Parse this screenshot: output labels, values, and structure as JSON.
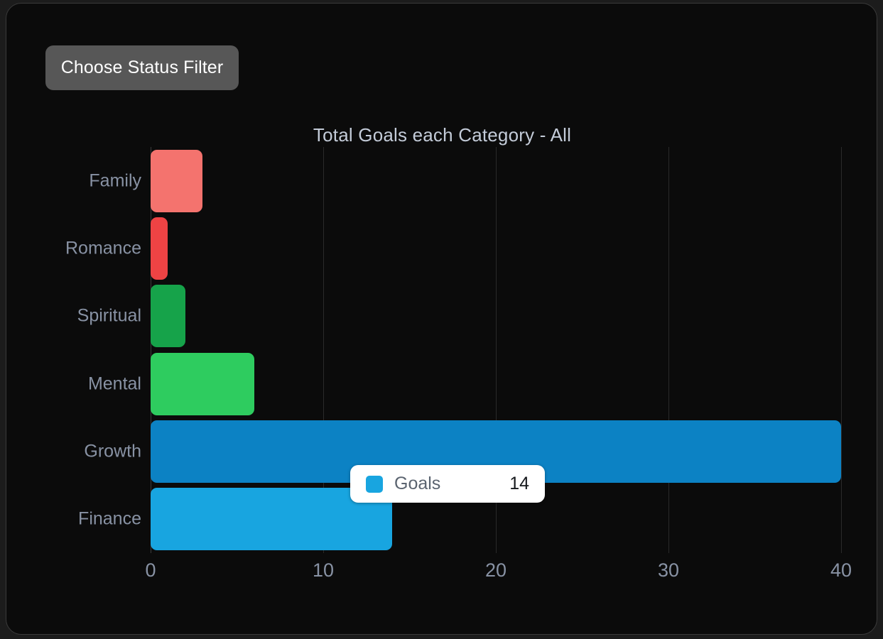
{
  "theme": {
    "page_background": "#1c1c1c",
    "card_background": "#0b0b0b",
    "card_border": "#3a3a3a",
    "axis_text": "#8892a4",
    "title_text": "#c3cbd8",
    "grid": "#2a2a2a"
  },
  "toolbar": {
    "status_filter_label": "Choose Status Filter",
    "status_filter_background": "#575757",
    "status_filter_text_color": "#ffffff"
  },
  "tooltip": {
    "series_label": "Goals",
    "value": "14",
    "swatch_color": "#18a5e0",
    "background": "#ffffff"
  },
  "chart_data": {
    "type": "bar",
    "orientation": "horizontal",
    "title": "Total Goals each Category - All",
    "xlabel": "",
    "ylabel": "",
    "categories": [
      "Family",
      "Romance",
      "Spiritual",
      "Mental",
      "Growth",
      "Finance"
    ],
    "values": [
      3,
      1,
      2,
      6,
      40,
      14
    ],
    "series": [
      {
        "name": "Goals",
        "values": [
          3,
          1,
          2,
          6,
          40,
          14
        ]
      }
    ],
    "bar_colors": [
      "#f4736e",
      "#ee4344",
      "#16a34a",
      "#2ecc5f",
      "#0c82c4",
      "#18a5e0"
    ],
    "xlim": [
      0,
      40
    ],
    "xticks": [
      "0",
      "10",
      "20",
      "30",
      "40"
    ],
    "xtick_values": [
      0,
      10,
      20,
      30,
      40
    ],
    "grid": true,
    "legend": "none"
  }
}
